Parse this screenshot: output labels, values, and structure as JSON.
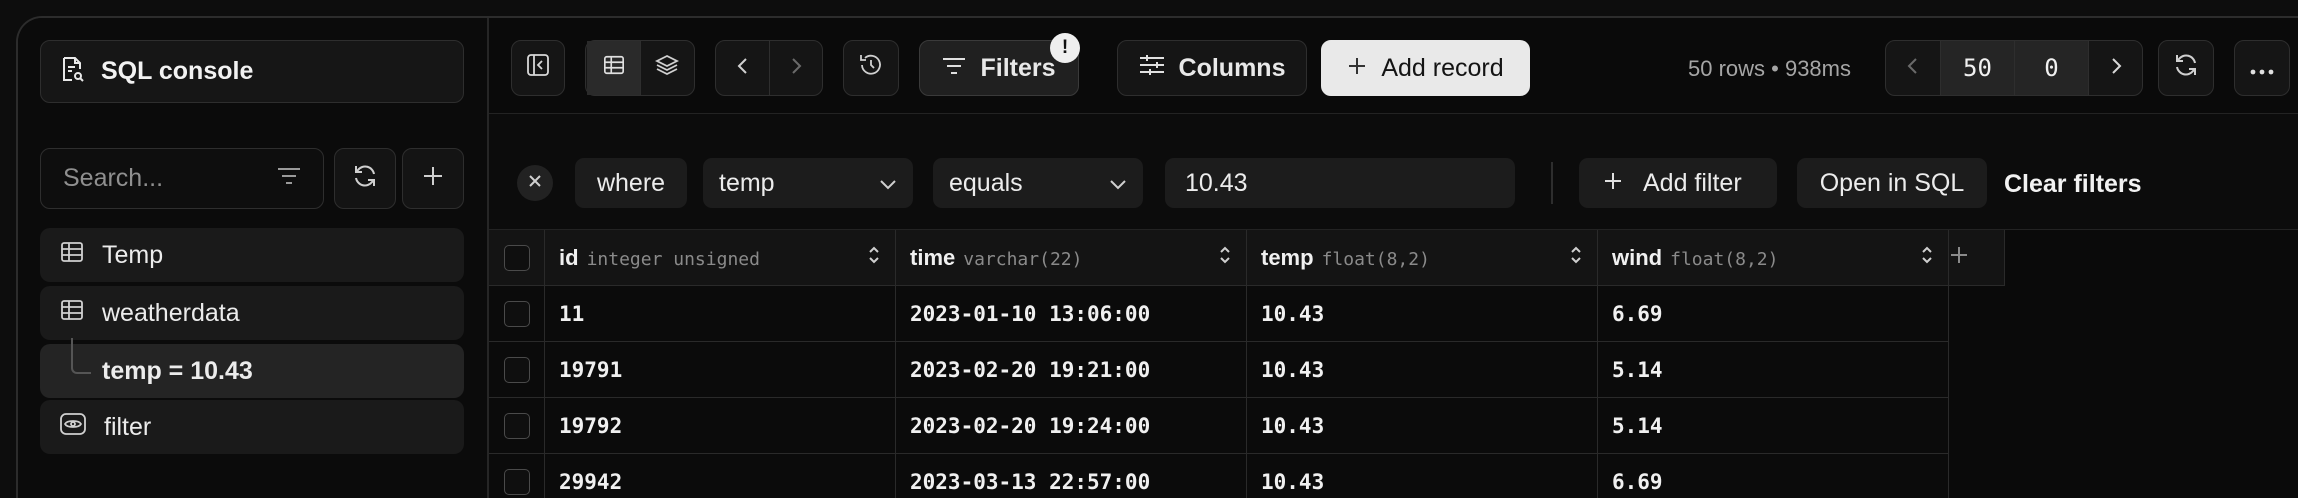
{
  "sidebar": {
    "sql_console": "SQL console",
    "search_placeholder": "Search...",
    "items": [
      {
        "label": "Temp",
        "icon": "table-icon"
      },
      {
        "label": "weatherdata",
        "icon": "table-icon"
      },
      {
        "label": "temp = 10.43",
        "icon": "tree-branch"
      },
      {
        "label": "filter",
        "icon": "eye-icon"
      }
    ]
  },
  "toolbar": {
    "filters_label": "Filters",
    "filters_badge": "!",
    "columns_label": "Columns",
    "add_record_label": "Add record",
    "row_info": "50 rows • 938ms",
    "limit": "50",
    "offset": "0"
  },
  "filter": {
    "where_label": "where",
    "column": "temp",
    "operator": "equals",
    "value": "10.43",
    "add_filter_label": "Add filter",
    "open_sql_label": "Open in SQL",
    "clear_label": "Clear filters"
  },
  "table": {
    "columns": [
      {
        "name": "id",
        "type": "integer unsigned"
      },
      {
        "name": "time",
        "type": "varchar(22)"
      },
      {
        "name": "temp",
        "type": "float(8,2)"
      },
      {
        "name": "wind",
        "type": "float(8,2)"
      }
    ],
    "rows": [
      [
        "11",
        "2023-01-10 13:06:00",
        "10.43",
        "6.69"
      ],
      [
        "19791",
        "2023-02-20 19:21:00",
        "10.43",
        "5.14"
      ],
      [
        "19792",
        "2023-02-20 19:24:00",
        "10.43",
        "5.14"
      ],
      [
        "29942",
        "2023-03-13 22:57:00",
        "10.43",
        "6.69"
      ]
    ]
  },
  "colors": {
    "background": "#0a0a0a",
    "panel": "#151515",
    "border": "#2e2e2e",
    "accent_button": "#e9e9e9",
    "text": "#ececec"
  }
}
